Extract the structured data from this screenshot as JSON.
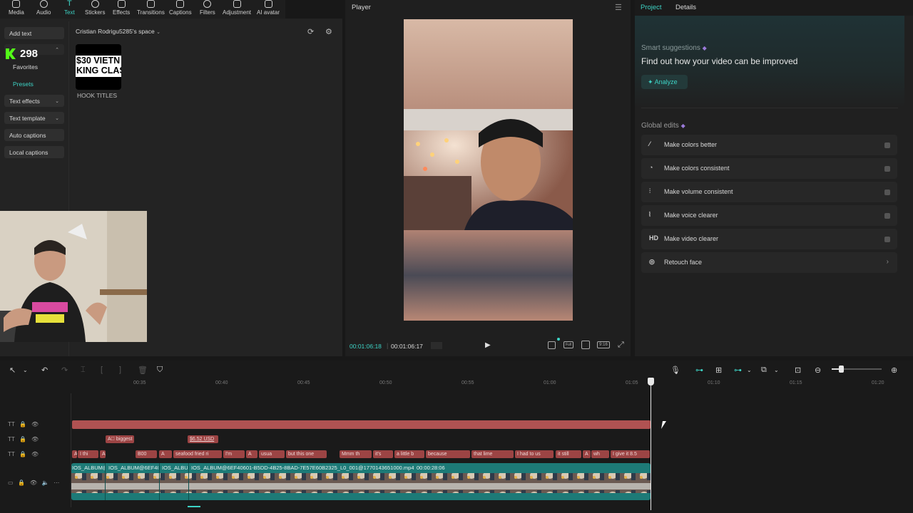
{
  "toolbar": {
    "items": [
      {
        "label": "Media",
        "icon": "media-icon"
      },
      {
        "label": "Audio",
        "icon": "audio-icon"
      },
      {
        "label": "Text",
        "icon": "text-icon",
        "active": true
      },
      {
        "label": "Stickers",
        "icon": "stickers-icon"
      },
      {
        "label": "Effects",
        "icon": "effects-icon"
      },
      {
        "label": "Transitions",
        "icon": "transitions-icon"
      },
      {
        "label": "Captions",
        "icon": "captions-icon"
      },
      {
        "label": "Filters",
        "icon": "filters-icon"
      },
      {
        "label": "Adjustment",
        "icon": "adjustment-icon"
      },
      {
        "label": "AI avatar",
        "icon": "ai-avatar-icon"
      }
    ]
  },
  "sidebar": {
    "add_text": "Add text",
    "stream_badge": "298",
    "favorites": "Favorites",
    "presets": "Presets",
    "text_effects": "Text effects",
    "text_template": "Text template",
    "auto_captions": "Auto captions",
    "local_captions": "Local captions"
  },
  "library": {
    "space_title": "Cristian Rodrigu5285's space",
    "thumb_text_line1": "$30 VIETN",
    "thumb_text_line2": "KING CLAS",
    "thumb_label": "HOOK TITLES"
  },
  "player": {
    "title": "Player",
    "current_time": "00:01:06:18",
    "total_time": "00:01:06:17",
    "ratio_label": "9:16",
    "full_label": "Full"
  },
  "right_panel": {
    "tabs": [
      "Project",
      "Details"
    ],
    "smart_title": "Smart suggestions",
    "smart_headline": "Find out how your video can be improved",
    "analyze_label": "Analyze",
    "global_edits_title": "Global edits",
    "edits": [
      {
        "label": "Make colors better",
        "icon": "magic-wand-icon"
      },
      {
        "label": "Make colors consistent",
        "icon": "color-drop-icon"
      },
      {
        "label": "Make volume consistent",
        "icon": "volume-sliders-icon"
      },
      {
        "label": "Make voice clearer",
        "icon": "voice-wave-icon"
      },
      {
        "label": "Make video clearer",
        "icon": "hd-icon",
        "glyph": "HD"
      },
      {
        "label": "Retouch face",
        "icon": "face-retouch-icon"
      }
    ]
  },
  "timeline": {
    "ruler": [
      "00:35",
      "00:40",
      "00:45",
      "00:50",
      "00:55",
      "01:00",
      "01:05",
      "01:10",
      "01:15",
      "01:20"
    ],
    "title_chips": [
      "biggest",
      "$6.52 USD"
    ],
    "caption_chips": [
      "A",
      "I thi",
      "A",
      "B00",
      "A",
      "seafood fried ri",
      "I'm",
      "A",
      "usua",
      "but this one",
      "Mmm th",
      "it's",
      "a little b",
      "because",
      "that lime",
      "I had to us",
      "it still",
      "A",
      "wh",
      "I give it 8.5"
    ],
    "video_track": {
      "clip1": "IOS_ALBUM@6EF40601-E",
      "clip2": "IOS_ALBUM@6EF40",
      "clip3": "IOS_ALBU",
      "clip4": "IOS_ALBUM@6EF40601-B5DD-4B25-8BAD-7E57E60B2325_L0_001@1770143651000.mp4",
      "clip4_duration": "00:00:28:06"
    }
  },
  "colors": {
    "accent": "#3dd4c6",
    "title_track": "#b05252",
    "video_track": "#1d7a77"
  }
}
